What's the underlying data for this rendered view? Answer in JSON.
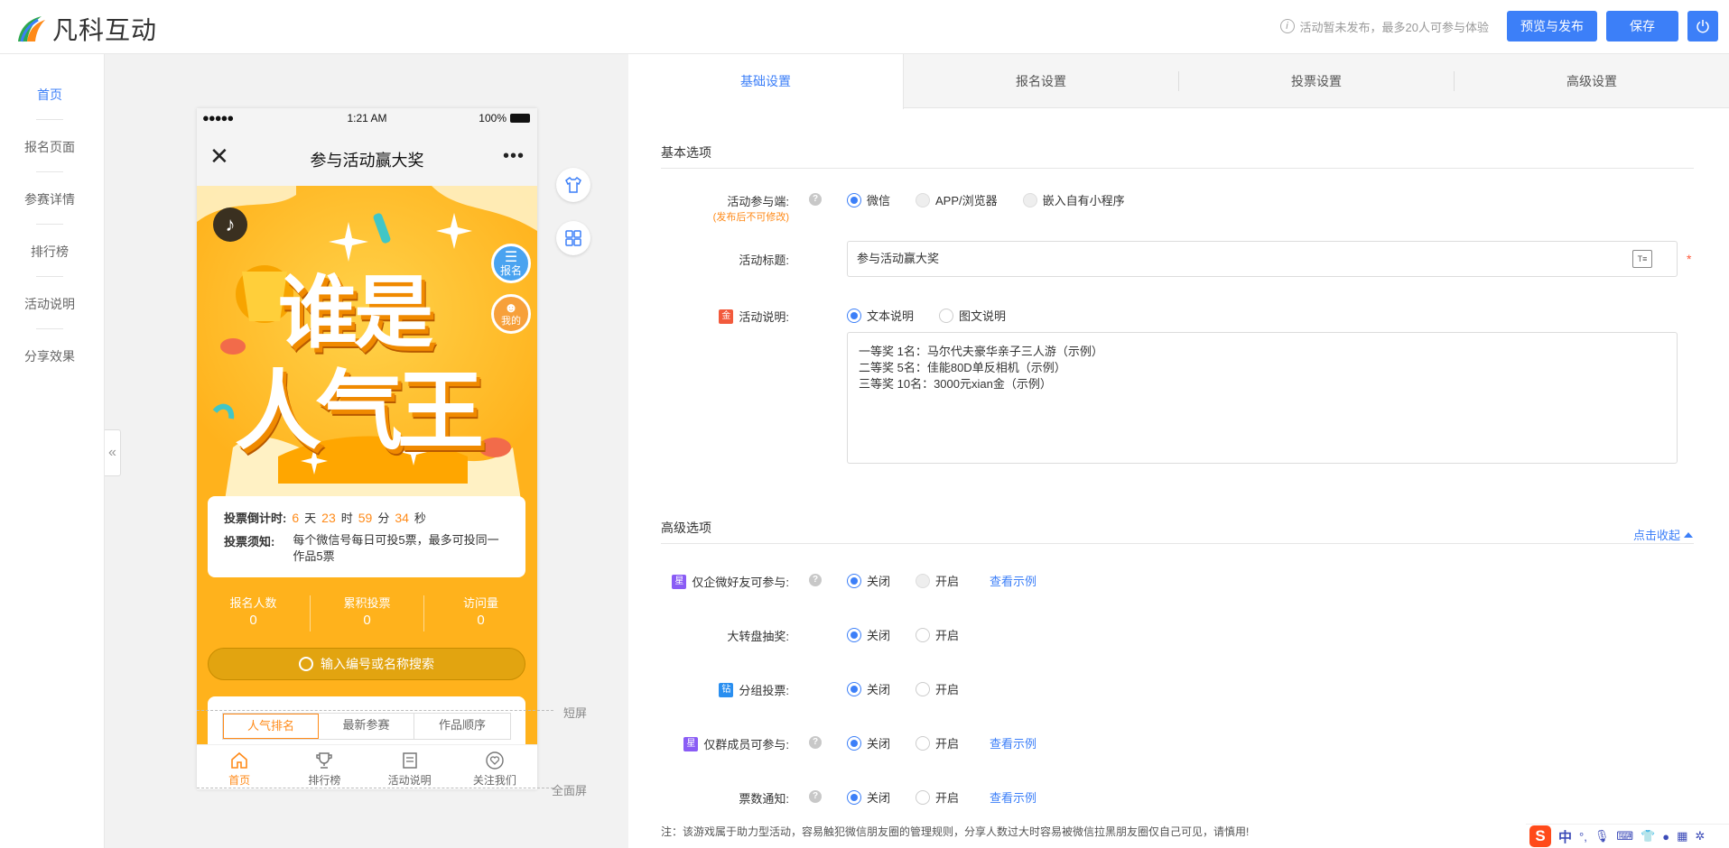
{
  "header": {
    "logo_text": "凡科互动",
    "status_text": "活动暂未发布，最多20人可参与体验",
    "preview_button": "预览与发布",
    "save_button": "保存"
  },
  "left_nav": {
    "items": [
      {
        "label": "首页",
        "active": true
      },
      {
        "label": "报名页面",
        "active": false
      },
      {
        "label": "参赛详情",
        "active": false
      },
      {
        "label": "排行榜",
        "active": false
      },
      {
        "label": "活动说明",
        "active": false
      },
      {
        "label": "分享效果",
        "active": false
      }
    ],
    "collapse_glyph": "«"
  },
  "phone": {
    "status": {
      "signal": "●●●●●",
      "time": "1:21 AM",
      "battery": "100%"
    },
    "nav_title": "参与活动赢大奖",
    "close_glyph": "✕",
    "more_glyph": "•••",
    "banner": {
      "line1": "谁是",
      "line2": "人气王",
      "signup_badge": "报名",
      "mine_badge": "我的"
    },
    "countdown": {
      "label": "投票倒计时:",
      "days": "6",
      "days_unit": "天",
      "hours": "23",
      "hours_unit": "时",
      "minutes": "59",
      "minutes_unit": "分",
      "seconds": "34",
      "seconds_unit": "秒"
    },
    "rules": {
      "label": "投票须知:",
      "text": "每个微信号每日可投5票，最多可投同一作品5票"
    },
    "stats": [
      {
        "label": "报名人数",
        "value": "0"
      },
      {
        "label": "累积投票",
        "value": "0"
      },
      {
        "label": "访问量",
        "value": "0"
      }
    ],
    "search_placeholder": "输入编号或名称搜索",
    "rank_tabs": [
      {
        "label": "人气排名",
        "active": true
      },
      {
        "label": "最新参赛",
        "active": false
      },
      {
        "label": "作品顺序",
        "active": false
      }
    ],
    "tabbar": [
      {
        "label": "首页",
        "icon": "home-icon",
        "active": true
      },
      {
        "label": "排行榜",
        "icon": "trophy-icon",
        "active": false
      },
      {
        "label": "活动说明",
        "icon": "document-icon",
        "active": false
      },
      {
        "label": "关注我们",
        "icon": "heart-icon",
        "active": false
      }
    ]
  },
  "preview_side": {
    "short_screen_label": "短屏",
    "full_screen_label": "全面屏"
  },
  "settings": {
    "tabs": [
      {
        "label": "基础设置",
        "active": true
      },
      {
        "label": "报名设置",
        "active": false
      },
      {
        "label": "投票设置",
        "active": false
      },
      {
        "label": "高级设置",
        "active": false
      }
    ],
    "basic_section_title": "基本选项",
    "platform": {
      "label": "活动参与端:",
      "sublabel": "(发布后不可修改)",
      "options": [
        {
          "label": "微信",
          "checked": true,
          "disabled": false
        },
        {
          "label": "APP/浏览器",
          "checked": false,
          "disabled": true
        },
        {
          "label": "嵌入自有小程序",
          "checked": false,
          "disabled": true
        }
      ]
    },
    "title_field": {
      "label": "活动标题:",
      "value": "参与活动赢大奖",
      "required_mark": "*"
    },
    "description": {
      "label": "活动说明:",
      "badge": "金",
      "options": [
        {
          "label": "文本说明",
          "checked": true
        },
        {
          "label": "图文说明",
          "checked": false
        }
      ],
      "text": "一等奖 1名：马尔代夫豪华亲子三人游（示例）\n二等奖 5名：佳能80D单反相机（示例）\n三等奖 10名：3000元xian金（示例）"
    },
    "advanced_section_title": "高级选项",
    "collapse_link": "点击收起",
    "advanced_rows": [
      {
        "label": "仅企微好友可参与:",
        "badge": "星",
        "badge_color": "#8a5cf5",
        "help": true,
        "off_label": "关闭",
        "on_label": "开启",
        "on_disabled": true,
        "example": "查看示例"
      },
      {
        "label": "大转盘抽奖:",
        "badge": "",
        "badge_color": "",
        "help": false,
        "off_label": "关闭",
        "on_label": "开启",
        "on_disabled": false,
        "example": ""
      },
      {
        "label": "分组投票:",
        "badge": "钻",
        "badge_color": "#2a8ff0",
        "help": false,
        "off_label": "关闭",
        "on_label": "开启",
        "on_disabled": false,
        "example": ""
      },
      {
        "label": "仅群成员可参与:",
        "badge": "星",
        "badge_color": "#8a5cf5",
        "help": true,
        "off_label": "关闭",
        "on_label": "开启",
        "on_disabled": false,
        "example": "查看示例"
      },
      {
        "label": "票数通知:",
        "badge": "",
        "badge_color": "",
        "help": true,
        "off_label": "关闭",
        "on_label": "开启",
        "on_disabled": false,
        "example": "查看示例"
      }
    ],
    "footnote": "注：该游戏属于助力型活动，容易触犯微信朋友圈的管理规则，分享人数过大时容易被微信拉黑朋友圈仅自己可见，请慎用!"
  },
  "ime_bar": {
    "s_logo": "S",
    "lang": "中",
    "punct": "°,"
  },
  "colors": {
    "accent": "#3c7ff8",
    "orange": "#ff8a18",
    "phone_bg": "#ffb21c"
  }
}
